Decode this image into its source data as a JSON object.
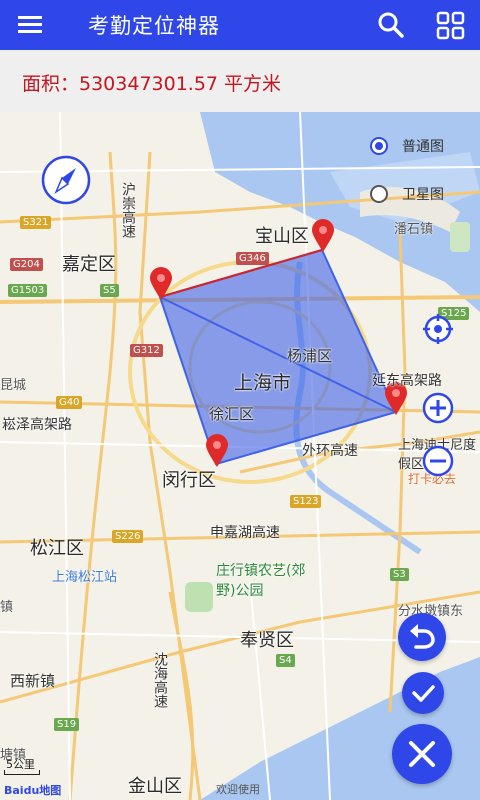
{
  "app": {
    "title": "考勤定位神器"
  },
  "area": {
    "text": "面积：530347301.57 平方米"
  },
  "map": {
    "layers": {
      "normal": "普通图",
      "satellite": "卫星图",
      "selected": "normal"
    },
    "labels": {
      "baoshan": "宝山区",
      "jiading": "嘉定区",
      "shanghai": "上海市",
      "yangpu": "杨浦区",
      "xuhui": "徐汇区",
      "minhang": "闵行区",
      "songjiang": "松江区",
      "fengxian": "奉贤区",
      "jinshan": "金山区",
      "xixin": "西新镇",
      "panshi": "潘石镇",
      "disney": "上海迪士尼度假区",
      "daka": "打卡必去",
      "fenshui": "分水墩镇东",
      "zhuanghang": "庄行镇农艺(郊野)公园",
      "songjiang_station": "上海松江站",
      "huhong": "沪崇高速",
      "shenhu": "申嘉湖高速",
      "waihuan": "外环高速",
      "yanjiang": "延东高架路",
      "songze": "崧泽高架路",
      "shenjin": "沈海高速",
      "kuncheng": "昆城",
      "zhen": "镇",
      "tangzhen": "塘镇"
    },
    "roads": [
      "S321",
      "G204",
      "G1503",
      "S5",
      "G346",
      "G312",
      "S125",
      "G40",
      "S123",
      "S226",
      "S3",
      "S4",
      "S19"
    ],
    "scale": "5公里",
    "brand": "Baidu地图",
    "footer": "欢迎使用"
  },
  "colors": {
    "primary": "#2f47e8",
    "area_text": "#c8151d",
    "polygon": "#3f63e8"
  }
}
